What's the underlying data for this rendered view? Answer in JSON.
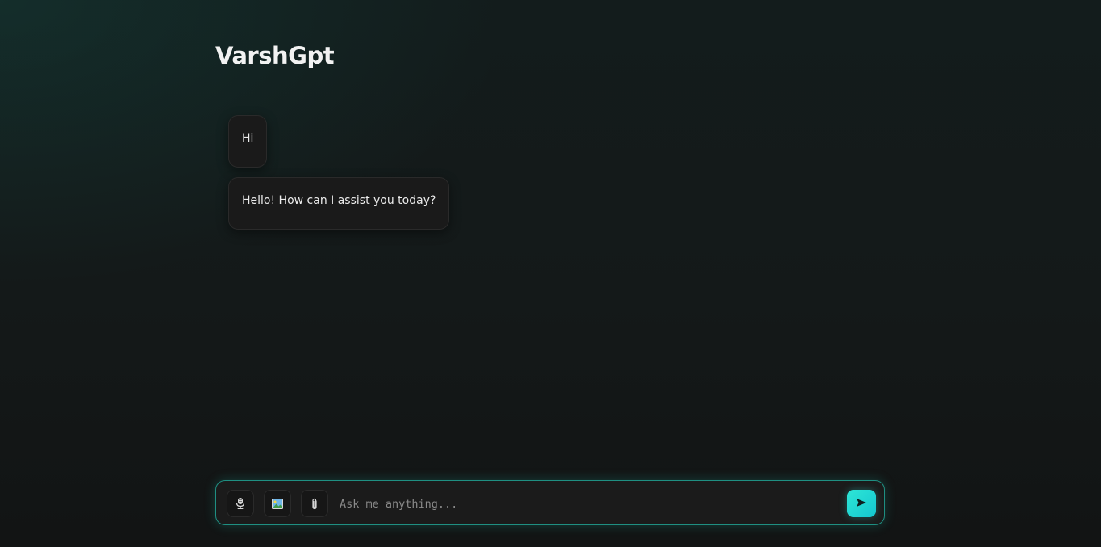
{
  "app": {
    "title": "VarshGpt"
  },
  "messages": [
    {
      "role": "user",
      "text": "Hi"
    },
    {
      "role": "assistant",
      "text": "Hello! How can I assist you today?"
    }
  ],
  "composer": {
    "placeholder": "Ask me anything...",
    "value": "",
    "tools": [
      {
        "icon": "microphone-icon"
      },
      {
        "icon": "image-icon"
      },
      {
        "icon": "paperclip-icon"
      }
    ],
    "send_icon": "send-arrow-icon"
  },
  "colors": {
    "accent": "#22d3c5",
    "composer_border": "#1f8f82",
    "bubble_bg": "#1a1a1a"
  }
}
